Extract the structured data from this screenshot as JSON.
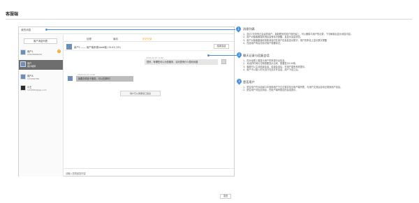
{
  "page": {
    "title": "客服端"
  },
  "frame": {
    "title": "我的消息"
  },
  "left": {
    "list_button": "用户消息列表",
    "users": [
      {
        "name": "用户1",
        "info": "15625889556",
        "badge": "3"
      },
      {
        "name": "用户",
        "info": "用户昵称"
      },
      {
        "name": "用户A",
        "info": "123456789"
      },
      {
        "name": "小王",
        "info": "1234554@qq.com"
      }
    ]
  },
  "tabs": [
    "处理",
    "离线",
    "历史记录"
  ],
  "chat": {
    "header_user": "用户1 —— 用户端来源(web端)  15:43 (15)",
    "end_button": "结束会话",
    "messages": [
      {
        "time": "2019-04-15  14:40",
        "text": "您好，有哪些可以为您服务，请问您有什么想问问题",
        "side": "right"
      },
      {
        "time": "2019-04-15  14:40",
        "text": "我要怎样处于服务，可以在那吗？",
        "side": "left"
      }
    ],
    "transfer_button": "用户已从客服窗口退出",
    "input_placeholder": "请输入您的回复内容",
    "send_button": "发送"
  },
  "notes": [
    {
      "num": "1",
      "title": "消息列表",
      "lines": [
        "1、显示7天内有过会话的用户，最新联系的用户排在最上，可以删除与用户的记录，下次刷新后显示消息内容。",
        "2、用户对接客服接到消息会有标识提醒，且显示会话状态。",
        "3、用户对接客服接收到新消息时在用户信息处显示数字，用户的条目上显示数字提醒",
        "4、在线用户有高亮标识用户需要标记。"
      ]
    },
    {
      "num": "2",
      "title": "聊天记录与回复会话",
      "lines": [
        "1、在对话框上端显示用户的来源平台信息。",
        "2、对话的时间与日期需要显示出来，需要显示100条。",
        "3、客服可以主动结束会话，结束会话后，在用户端有系统提示。",
        "4、用户不以接入时长自行在此打开会话，用户下线之后。"
      ]
    },
    {
      "num": "3",
      "title": "是否用户",
      "lines": [
        "1、是否用户在对话窗口中选择用户下达记录并显示用户端列表，与用户交流后自动记录到用户信息。",
        "2、是否用户对应此消息，在用户端有相应的会话提示。"
      ]
    }
  ],
  "colors": {
    "accent": "#4a90d9",
    "tab_active": "#f5a623"
  }
}
